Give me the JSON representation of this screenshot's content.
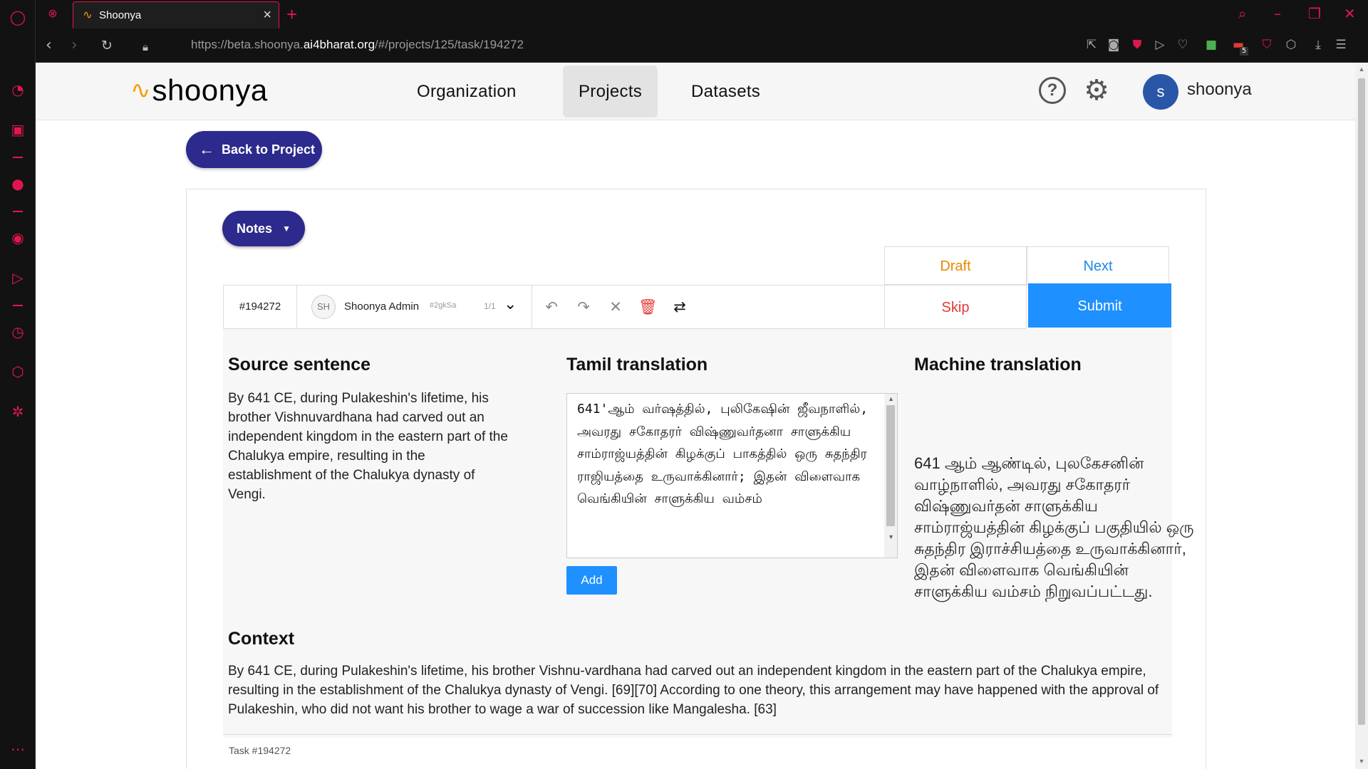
{
  "browser": {
    "tab_title": "Shoonya",
    "url_prefix": "https://beta.shoonya.",
    "url_domain": "ai4bharat.org",
    "url_path": "/#/projects/125/task/194272",
    "extension_badge": "5"
  },
  "app": {
    "logo_text": "shoonya",
    "nav": [
      "Organization",
      "Projects",
      "Datasets"
    ],
    "active_nav": "Projects",
    "user_initial": "s",
    "user_name": "shoonya"
  },
  "page": {
    "back_label": "Back to Project",
    "notes_label": "Notes",
    "draft_label": "Draft",
    "next_label": "Next",
    "skip_label": "Skip",
    "submit_label": "Submit",
    "task_id": "#194272",
    "annotator_initials": "SH",
    "annotator_name": "Shoonya Admin",
    "annotator_hash": "#2gkSa",
    "annotation_count": "1/1",
    "source_title": "Source sentence",
    "source_text": "By 641 CE, during Pulakeshin's lifetime, his brother Vishnuvardhana had carved out an independent kingdom in the eastern part of the Chalukya empire, resulting in the establishment of the Chalukya dynasty of Vengi.",
    "translation_title": "Tamil translation",
    "translation_text": "641'ஆம் வர்ஷத்தில், புலிகேஷின் ஜீவநாளில், அவரது சகோதரர் விஷ்ணுவர்தனா சாளுக்கிய சாம்ராஜ்யத்தின் கிழக்குப் பாகத்தில் ஒரு சுதந்திர ராஜியத்தை உருவாக்கினார்; இதன் விளைவாக வெங்கியின் சாளுக்கிய வம்சம்",
    "add_label": "Add",
    "mt_title": "Machine translation",
    "mt_text": "641 ஆம் ஆண்டில், புலகேசனின் வாழ்நாளில், அவரது சகோதரர் விஷ்ணுவர்தன் சாளுக்கிய சாம்ராஜ்யத்தின் கிழக்குப் பகுதியில் ஒரு சுதந்திர இராச்சியத்தை உருவாக்கினார், இதன் விளைவாக வெங்கியின் சாளுக்கிய வம்சம் நிறுவப்பட்டது.",
    "context_title": "Context",
    "context_text": "By 641 CE, during Pulakeshin's lifetime, his brother Vishnu-vardhana had carved out an independent kingdom in the eastern part of the Chalukya empire, resulting in the establishment of the Chalukya dynasty of Vengi. [69][70] According to one theory, this arrangement may have happened with the approval of Pulakeshin, who did not want his brother to wage a war of succession like Mangalesha. [63]",
    "footer_task": "Task #194272"
  },
  "colors": {
    "primary": "#2c2a8c",
    "submit": "#1e90ff",
    "draft": "#e68a00",
    "skip": "#e53935",
    "browser_accent": "#e0174f"
  }
}
